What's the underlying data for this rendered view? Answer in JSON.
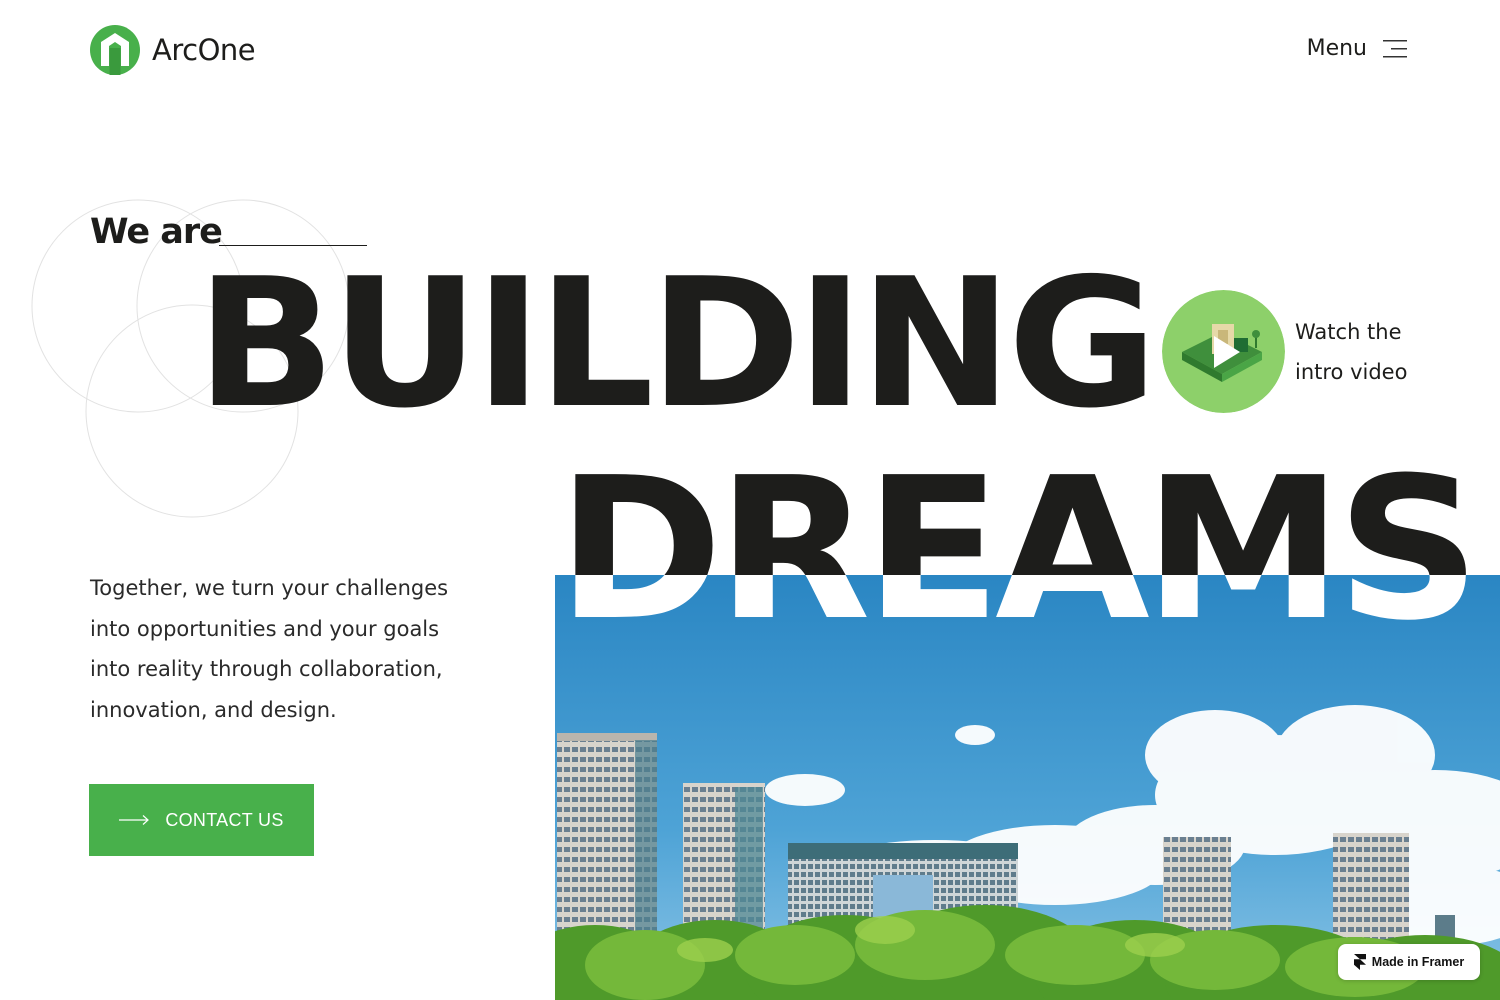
{
  "brand": {
    "name": "ArcOne",
    "accent_color": "#48b04b",
    "logo_icon": "arch-logo-icon"
  },
  "nav": {
    "menu_label": "Menu",
    "menu_icon": "hamburger-icon"
  },
  "hero": {
    "eyebrow": "We are",
    "headline_1": "BUILDING",
    "headline_2": "DREAMS",
    "video_caption_line1": "Watch the",
    "video_caption_line2": "intro video",
    "video_icon": "play-icon",
    "description": "Together, we turn your challenges into opportunities and your goals into reality through collaboration, innovation, and design.",
    "cta_label": "CONTACT US",
    "cta_icon": "arrow-right-icon",
    "image_subject": "city skyline with skyscrapers over green trees and blue sky"
  },
  "badge": {
    "label": "Made in Framer",
    "icon": "framer-icon"
  }
}
